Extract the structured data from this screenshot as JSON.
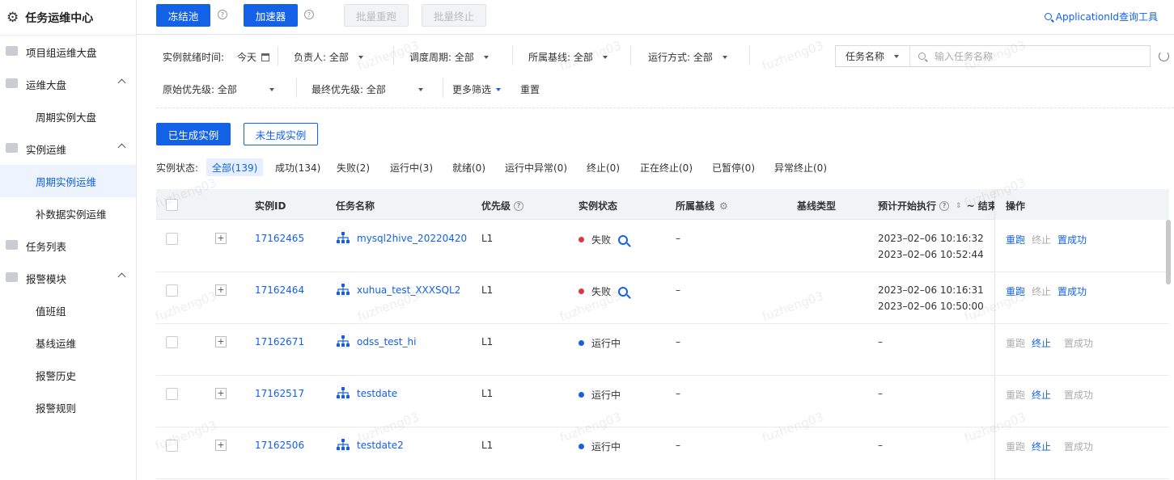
{
  "app": {
    "title": "任务运维中心"
  },
  "sidebar": {
    "items": [
      {
        "label": "项目组运维大盘"
      },
      {
        "label": "运维大盘"
      },
      {
        "label": "周期实例大盘"
      },
      {
        "label": "实例运维"
      },
      {
        "label": "周期实例运维"
      },
      {
        "label": "补数据实例运维"
      },
      {
        "label": "任务列表"
      },
      {
        "label": "报警模块"
      },
      {
        "label": "值班组"
      },
      {
        "label": "基线运维"
      },
      {
        "label": "报警历史"
      },
      {
        "label": "报警规则"
      }
    ]
  },
  "toolbar": {
    "freeze_pool": "冻结池",
    "accelerator": "加速器",
    "batch_rerun": "批量重跑",
    "batch_stop": "批量终止",
    "app_id_tool": "ApplicationId查询工具"
  },
  "filters": {
    "ready_time_label": "实例就绪时间:",
    "ready_time_value": "今天",
    "owner": "负责人: 全部",
    "period": "调度周期: 全部",
    "baseline": "所属基线: 全部",
    "run_mode": "运行方式: 全部",
    "orig_priority": "原始优先级: 全部",
    "final_priority": "最终优先级: 全部",
    "more_filters": "更多筛选",
    "reset": "重置",
    "search_category": "任务名称",
    "search_placeholder": "输入任务名称"
  },
  "instance_tabs": {
    "generated": "已生成实例",
    "not_generated": "未生成实例"
  },
  "status_filter": {
    "label": "实例状态:",
    "tabs": [
      "全部(139)",
      "成功(134)",
      "失败(2)",
      "运行中(3)",
      "就绪(0)",
      "运行中异常(0)",
      "终止(0)",
      "正在终止(0)",
      "已暂停(0)",
      "异常终止(0)"
    ]
  },
  "table": {
    "headers": {
      "id": "实例ID",
      "name": "任务名称",
      "priority": "优先级",
      "status": "实例状态",
      "baseline": "所属基线",
      "baseline_type": "基线类型",
      "time": "预计开始执行",
      "time_end": "~ 结束",
      "ops": "操作"
    },
    "rows": [
      {
        "id": "17162465",
        "name": "mysql2hive_20220420",
        "priority": "L1",
        "status": "失败",
        "baseline": "–",
        "start": "2023–02–06 10:16:32",
        "end": "2023–02–06 10:52:44",
        "op1": "重跑",
        "op2": "终止",
        "op3": "置成功"
      },
      {
        "id": "17162464",
        "name": "xuhua_test_XXXSQL2",
        "priority": "L1",
        "status": "失败",
        "baseline": "–",
        "start": "2023–02–06 10:16:31",
        "end": "2023–02–06 10:50:00",
        "op1": "重跑",
        "op2": "终止",
        "op3": "置成功"
      },
      {
        "id": "17162671",
        "name": "odss_test_hi",
        "priority": "L1",
        "status": "运行中",
        "baseline": "–",
        "start": "–",
        "end": "",
        "op1": "重跑",
        "op2": "终止",
        "op3": "置成功"
      },
      {
        "id": "17162517",
        "name": "testdate",
        "priority": "L1",
        "status": "运行中",
        "baseline": "–",
        "start": "–",
        "end": "",
        "op1": "重跑",
        "op2": "终止",
        "op3": "置成功"
      },
      {
        "id": "17162506",
        "name": "testdate2",
        "priority": "L1",
        "status": "运行中",
        "baseline": "–",
        "start": "–",
        "end": "",
        "op1": "重跑",
        "op2": "终止",
        "op3": "置成功"
      }
    ]
  },
  "watermark": "fuzheng03",
  "colors": {
    "accent": "#1261e6",
    "failed": "#e5333f",
    "running": "#1261e6"
  }
}
